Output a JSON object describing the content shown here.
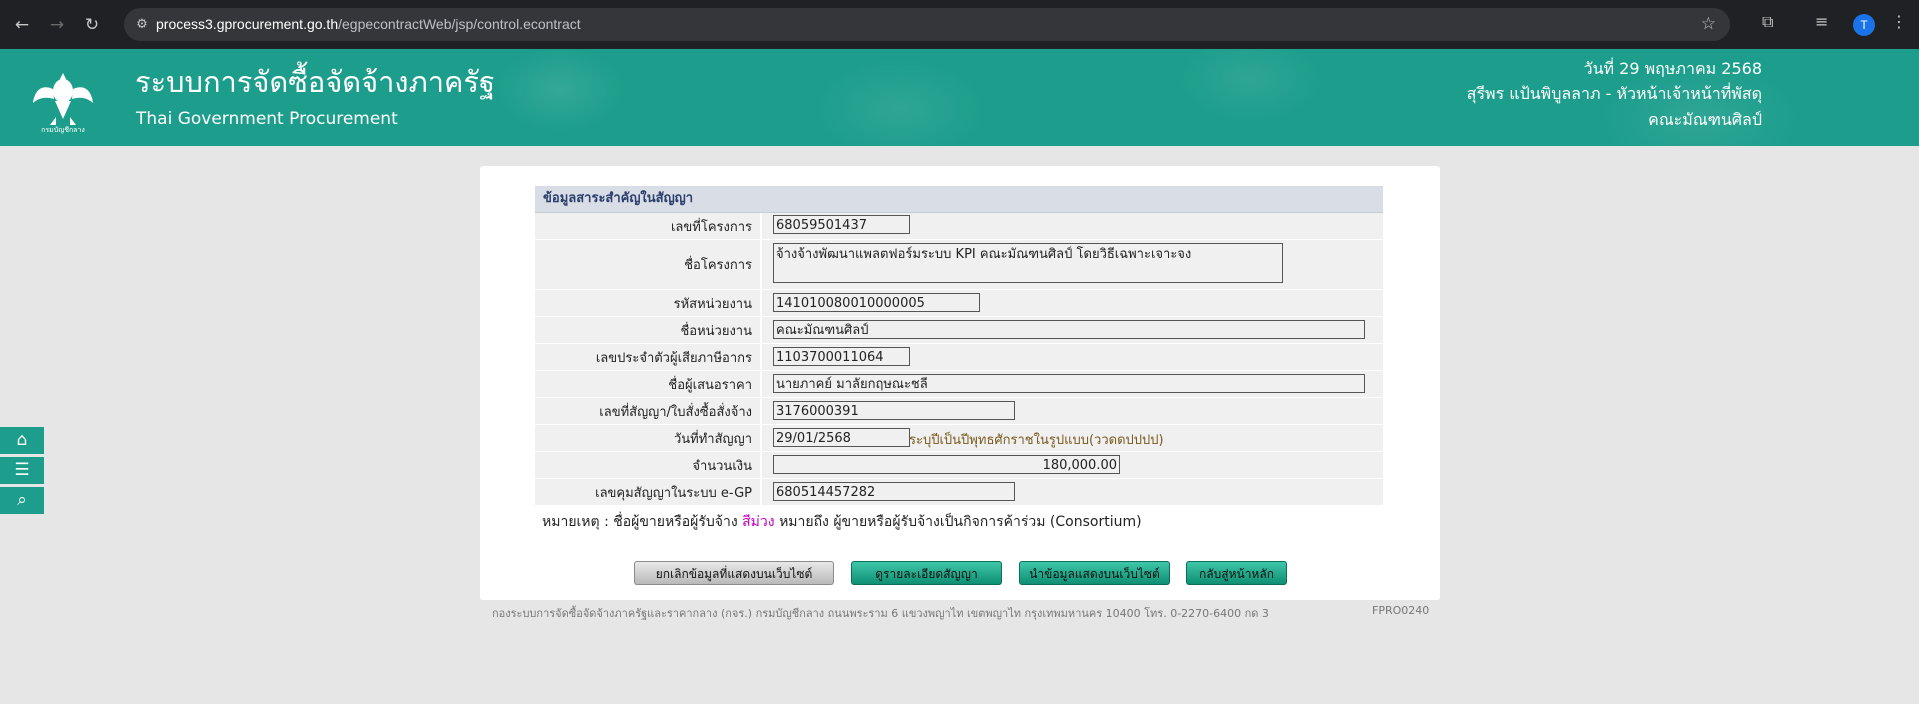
{
  "browser": {
    "url_host": "process3.gprocurement.go.th",
    "url_path": "/egpecontractWeb/jsp/control.econtract",
    "profile_initial": "T"
  },
  "header": {
    "title_th": "ระบบการจัดซื้อจัดจ้างภาครัฐ",
    "title_en": "Thai Government Procurement",
    "logo_text": "กรมบัญชีกลาง",
    "date": "วันที่ 29 พฤษภาคม 2568",
    "user": "สุรีพร แป้นพิบูลลาภ - หัวหน้าเจ้าหน้าที่พัสดุ",
    "department": "คณะมัณฑนศิลป์",
    "brand_color": "#1d9e8c"
  },
  "side_tools": [
    "home-icon",
    "menu-icon",
    "search-icon"
  ],
  "section": {
    "title": "ข้อมูลสาระสำคัญในสัญญา",
    "fields": {
      "project_no": {
        "label": "เลขที่โครงการ",
        "value": "68059501437"
      },
      "project_name": {
        "label": "ชื่อโครงการ",
        "value": "จ้างจ้างพัฒนาแพลตฟอร์มระบบ KPI คณะมัณฑนศิลป์ โดยวิธีเฉพาะเจาะจง"
      },
      "agency_code": {
        "label": "รหัสหน่วยงาน",
        "value": "141010080010000005"
      },
      "agency_name": {
        "label": "ชื่อหน่วยงาน",
        "value": "คณะมัณฑนศิลป์"
      },
      "tax_id": {
        "label": "เลขประจำตัวผู้เสียภาษีอากร",
        "value": "1103700011064"
      },
      "bidder_name": {
        "label": "ชื่อผู้เสนอราคา",
        "value": "นายภาคย์ มาลัยกฤษณะชลี"
      },
      "contract_no": {
        "label": "เลขที่สัญญา/ใบสั่งซื้อสั่งจ้าง",
        "value": "3176000391"
      },
      "contract_date": {
        "label": "วันที่ทำสัญญา",
        "value": "29/01/2568",
        "hint": "ระบุปีเป็นปีพุทธศักราชในรูปแบบ(ววดดปปปป)"
      },
      "amount": {
        "label": "จำนวนเงิน",
        "value": "180,000.00"
      },
      "egp_contract_no": {
        "label": "เลขคุมสัญญาในระบบ e-GP",
        "value": "680514457282"
      }
    }
  },
  "note": {
    "prefix": "หมายเหตุ : ชื่อผู้ขายหรือผู้รับจ้าง",
    "purple_word": "สีม่วง",
    "suffix": "หมายถึง ผู้ขายหรือผู้รับจ้างเป็นกิจการค้าร่วม (Consortium)"
  },
  "buttons": {
    "cancel_publish": "ยกเลิกข้อมูลที่แสดงบนเว็บไซต์",
    "view_contract": "ดูรายละเอียดสัญญา",
    "publish": "นำข้อมูลแสดงบนเว็บไซต์",
    "back_home": "กลับสู่หน้าหลัก"
  },
  "footer": {
    "text": "กองระบบการจัดซื้อจัดจ้างภาครัฐและราคากลาง (กจร.) กรมบัญชีกลาง ถนนพระราม 6 แขวงพญาไท เขตพญาไท กรุงเทพมหานคร 10400 โทร. 0-2270-6400 กด 3",
    "code": "FPRO0240"
  }
}
